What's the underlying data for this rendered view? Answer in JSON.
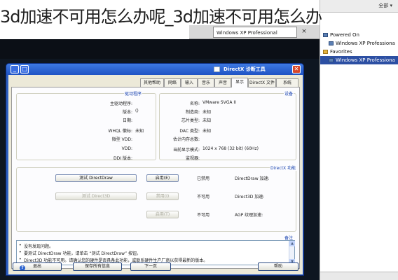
{
  "watermark_title": "3d加速不可用怎么办呢_3d加速不可用怎么办",
  "host_tabs": [
    {
      "label": "Windows XP Professional",
      "active": true
    }
  ],
  "side_panel": {
    "top_label": "全部 ▾",
    "tree": [
      {
        "label": "Powered On",
        "selected": false
      },
      {
        "label": "Windows XP Professiona",
        "selected": false
      },
      {
        "label": "Favorites",
        "selected": false
      },
      {
        "label": "Windows XP Professiona",
        "selected": true
      }
    ]
  },
  "dialog": {
    "title": "DirectX 诊断工具",
    "min_glyph": "_",
    "max_glyph": "□",
    "close_glyph": "✕",
    "tabs": [
      "系统",
      "DirectX 文件",
      "显示",
      "声音",
      "音乐",
      "输入",
      "网络",
      "其他帮助"
    ],
    "active_tab": "显示",
    "device_group_label": "设备",
    "device_rows": [
      {
        "k": "名称:",
        "v": "VMware SVGA II"
      },
      {
        "k": "制造商:",
        "v": "未知"
      },
      {
        "k": "芯片类型:",
        "v": "未知"
      },
      {
        "k": "DAC 类型:",
        "v": "未知"
      },
      {
        "k": "估计内存总数:",
        "v": ""
      },
      {
        "k": "当前显示模式:",
        "v": "1024 x 768 (32 bit) (60Hz)"
      },
      {
        "k": "监视器:",
        "v": ""
      }
    ],
    "driver_group_label": "驱动程序",
    "driver_rows": [
      {
        "k": "主驱动程序:",
        "v": ""
      },
      {
        "k": "版本:",
        "v": "()"
      },
      {
        "k": "日期:",
        "v": ""
      },
      {
        "k": "WHQL 徽标:",
        "v": "未知"
      },
      {
        "k": "微型 VDD:",
        "v": ""
      },
      {
        "k": "VDD:",
        "v": ""
      },
      {
        "k": "DDI 版本:",
        "v": ""
      }
    ],
    "features_group_label": "DirectX 功能",
    "features": [
      {
        "name": "DirectDraw 加速:",
        "status": "已禁用",
        "enable_label": "启用(E)",
        "test_label": "测试 DirectDraw",
        "enabled": true
      },
      {
        "name": "Direct3D 加速:",
        "status": "不可用",
        "enable_label": "禁用(I)",
        "test_label": "测试 Direct3D",
        "enabled": false
      },
      {
        "name": "AGP 纹理加速:",
        "status": "不可用",
        "enable_label": "启用(T)",
        "test_label": "",
        "enabled": false
      }
    ],
    "notes_group_label": "备注",
    "notes": [
      "没有发现问题。",
      "要测试 DirectDraw 功能，请单击 “测试 DirectDraw” 按钮。",
      "Direct3D 功能不可用。请确认您的硬件是否具备此功能，或联系硬件生产厂商以获得最新的版本。"
    ],
    "bottom_buttons": {
      "help": "帮助",
      "next": "下一页",
      "save": "保存所有信息",
      "exit": "退出"
    }
  }
}
